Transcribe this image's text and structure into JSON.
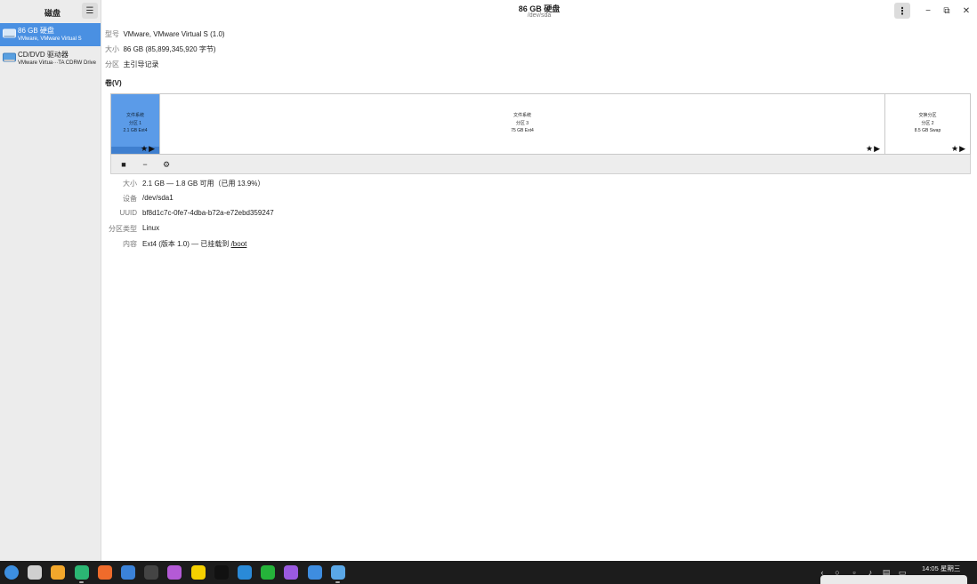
{
  "sidebar": {
    "title": "磁盘",
    "devices": [
      {
        "name": "86 GB 硬盘",
        "sub": "VMware, VMware Virtual S",
        "icon": "hard-disk-icon"
      },
      {
        "name": "CD/DVD 驱动器",
        "sub": "VMware Virtua···TA CDRW Drive",
        "icon": "optical-drive-icon"
      }
    ]
  },
  "header": {
    "title": "86 GB 硬盘",
    "subtitle": "/dev/sda",
    "minimize": "−",
    "maximize": "⧉",
    "close": "✕"
  },
  "drive_info": {
    "model_label": "型号",
    "model_value": "VMware, VMware Virtual S (1.0)",
    "size_label": "大小",
    "size_value": "86 GB (85,899,345,920 字节)",
    "partitioning_label": "分区",
    "partitioning_value": "主引导记录"
  },
  "volumes": {
    "title": "卷(V)",
    "partitions": [
      {
        "line1": "文件系统",
        "line2": "分区 1",
        "line3": "2.1 GB Ext4",
        "selected": true,
        "marks": "★▶"
      },
      {
        "line1": "文件系统",
        "line2": "分区 3",
        "line3": "75 GB Ext4",
        "selected": false,
        "marks": "★▶"
      },
      {
        "line1": "交换分区",
        "line2": "分区 2",
        "line3": "8.5 GB Swap",
        "selected": false,
        "marks": "★▶"
      }
    ],
    "partition_fractions": [
      0.0244,
      0.8791,
      0.0988
    ]
  },
  "toolbar": {
    "stop": "■",
    "remove": "−",
    "settings": "⚙"
  },
  "details": {
    "size_label": "大小",
    "size_value": "2.1 GB — 1.8 GB 可用（已用 13.9%）",
    "device_label": "设备",
    "device_value": "/dev/sda1",
    "uuid_label": "UUID",
    "uuid_value": "bf8d1c7c-0fe7-4dba-b72a-e72ebd359247",
    "type_label": "分区类型",
    "type_value": "Linux",
    "contents_label": "内容",
    "contents_prefix": "Ext4 (版本 1.0) — 已挂载到 ",
    "contents_link": "/boot"
  },
  "taskbar": {
    "clock": "14:05 星期三",
    "apps": [
      {
        "name": "launcher-icon",
        "color": "#3d8fe0"
      },
      {
        "name": "multitasking-icon",
        "color": "#cfcfcf"
      },
      {
        "name": "file-manager-icon",
        "color": "#f3a72b"
      },
      {
        "name": "app-store-icon",
        "color": "#2bb673"
      },
      {
        "name": "firefox-icon",
        "color": "#ef6b2b"
      },
      {
        "name": "chromium-icon",
        "color": "#3b82d8"
      },
      {
        "name": "terminal-icon",
        "color": "#444444"
      },
      {
        "name": "text-editor-icon",
        "color": "#b45ad6"
      },
      {
        "name": "browser-b-icon",
        "color": "#f5d000"
      },
      {
        "name": "qq-icon",
        "color": "#111111"
      },
      {
        "name": "kylin-icon",
        "color": "#2a8ad8"
      },
      {
        "name": "wechat-icon",
        "color": "#25b33a"
      },
      {
        "name": "music-icon",
        "color": "#9a5ae0"
      },
      {
        "name": "user-icon",
        "color": "#3e8de0"
      },
      {
        "name": "disks-icon",
        "color": "#5aa7e6"
      }
    ]
  }
}
